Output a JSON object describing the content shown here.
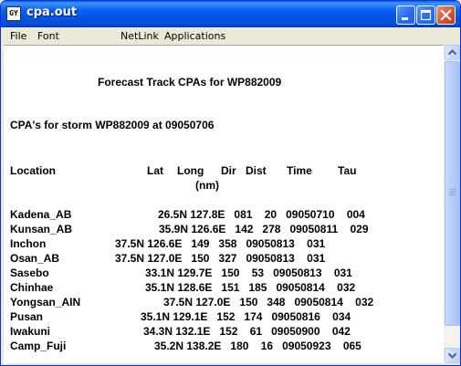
{
  "window": {
    "title": "cpa.out",
    "icon_text": "GY"
  },
  "menu": [
    "File",
    "Font",
    "NetLink",
    "Applications"
  ],
  "report": {
    "heading": "Forecast Track CPAs for WP882009",
    "subheading": "CPA's for storm WP882009 at 09050706",
    "headers": {
      "location": "Location",
      "lat": "Lat",
      "long": "Long",
      "dir": "Dir",
      "dist": "Dist",
      "time": "Time",
      "tau": "Tau",
      "units": "(nm)"
    },
    "rows": [
      {
        "name": "Kadena_AB",
        "data": "26.5N 127.8E   081    20   09050710    004"
      },
      {
        "name": "Kunsan_AB",
        "data": "35.9N 126.6E   142   278   09050811    029"
      },
      {
        "name": "Inchon",
        "data": "37.5N 126.6E   149   358   09050813    031"
      },
      {
        "name": "Osan_AB",
        "data": "37.5N 127.0E   150   327   09050813    031"
      },
      {
        "name": "Sasebo",
        "data": "33.1N 129.7E   150    53   09050813    031"
      },
      {
        "name": "Chinhae",
        "data": "35.1N 128.6E   151   185   09050814    032"
      },
      {
        "name": "Yongsan_AIN",
        "data": "37.5N 127.0E   150   348   09050814    032"
      },
      {
        "name": "Pusan",
        "data": "35.1N 129.1E   152   174   09050816    034"
      },
      {
        "name": "Iwakuni",
        "data": "34.3N 132.1E   152    61   09050900    042"
      },
      {
        "name": "Camp_Fuji",
        "data": "35.2N 138.2E   180    16   09050923    065"
      }
    ]
  },
  "colors": {
    "titlebar": "#0054e3",
    "close_button": "#d95530",
    "scrollbar": "#c7d9fc"
  },
  "icons": [
    "app-icon",
    "minimize-icon",
    "maximize-icon",
    "close-icon",
    "scroll-up-arrow-icon",
    "scroll-down-arrow-icon"
  ]
}
